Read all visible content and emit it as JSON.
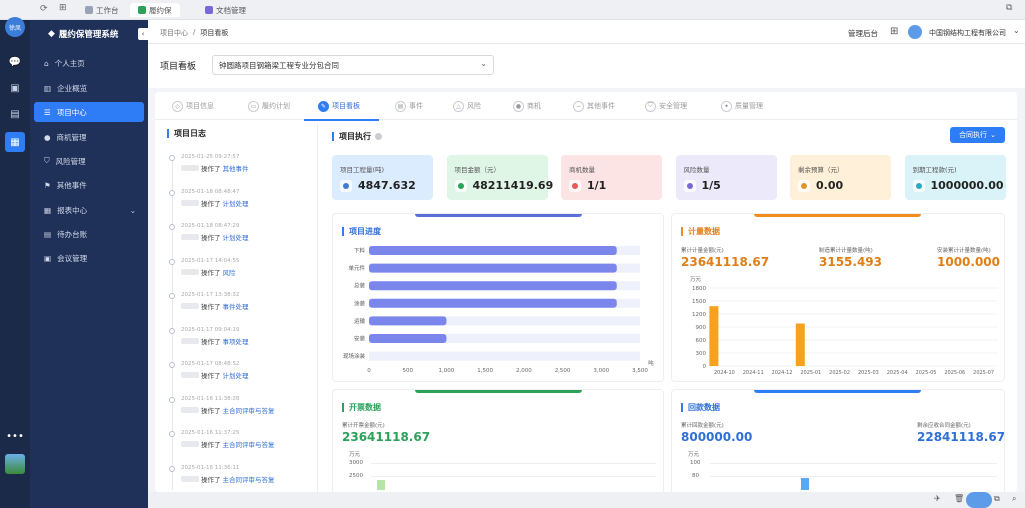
{
  "tabs": [
    {
      "label": "工作台",
      "active": false
    },
    {
      "label": "履约保",
      "active": true
    },
    {
      "label": "文档管理",
      "active": false
    }
  ],
  "rail": {
    "user_initials": "徐凤"
  },
  "sidebar": {
    "title": "履约保管理系统",
    "items": [
      {
        "label": "个人主页",
        "icon": "home-icon"
      },
      {
        "label": "企业概览",
        "icon": "building-icon"
      },
      {
        "label": "项目中心",
        "icon": "list-icon",
        "active": true
      },
      {
        "label": "商机管理",
        "icon": "pin-icon"
      },
      {
        "label": "风险管理",
        "icon": "shield-icon"
      },
      {
        "label": "其他事件",
        "icon": "flag-icon"
      },
      {
        "label": "报表中心",
        "icon": "report-icon",
        "has_children": true
      },
      {
        "label": "待办台账",
        "icon": "ledger-icon"
      },
      {
        "label": "会议管理",
        "icon": "meeting-icon"
      }
    ]
  },
  "header": {
    "breadcrumb": [
      "项目中心",
      "项目看板"
    ],
    "admin": "管理后台",
    "company": "中国钢结构工程有限公司"
  },
  "board": {
    "label": "项目看板",
    "selected_contract": "钟圆路项目钢箱梁工程专业分包合同"
  },
  "subtabs": [
    {
      "label": "项目信息"
    },
    {
      "label": "履约计划"
    },
    {
      "label": "项目看板",
      "active": true
    },
    {
      "label": "事件"
    },
    {
      "label": "风险"
    },
    {
      "label": "商机"
    },
    {
      "label": "其他事件"
    },
    {
      "label": "安全管理"
    },
    {
      "label": "质量管理"
    }
  ],
  "log": {
    "title": "项目日志",
    "entries": [
      {
        "time": "2025-01-25 09:27:57",
        "action": "操作了",
        "target": "其他事件"
      },
      {
        "time": "2025-01-18 08:48:47",
        "action": "操作了",
        "target": "计划处理"
      },
      {
        "time": "2025-01-18 08:47:29",
        "action": "操作了",
        "target": "计划处理"
      },
      {
        "time": "2025-01-17 14:04:55",
        "action": "操作了",
        "target": "风险"
      },
      {
        "time": "2025-01-17 13:38:32",
        "action": "操作了",
        "target": "事件处理"
      },
      {
        "time": "2025-01-17 09:04:19",
        "action": "操作了",
        "target": "事项处理"
      },
      {
        "time": "2025-01-17 08:48:52",
        "action": "操作了",
        "target": "计划处理"
      },
      {
        "time": "2025-01-16 11:38:28",
        "action": "操作了",
        "target": "主合同评审与答复"
      },
      {
        "time": "2025-01-16 11:37:25",
        "action": "操作了",
        "target": "主合同评审与答复"
      },
      {
        "time": "2025-01-16 11:36:11",
        "action": "操作了",
        "target": "主合同评审与答复"
      }
    ]
  },
  "execution": {
    "title": "项目执行",
    "button": "合同执行",
    "stats": [
      {
        "label": "项目工程量(吨)",
        "value": "4847.632",
        "bg": "#dcecff",
        "dot": "#3b7dd8"
      },
      {
        "label": "项目金额（元）",
        "value": "48211419.69",
        "bg": "#dff5e6",
        "dot": "#2ba15a"
      },
      {
        "label": "商机数量",
        "value": "1/1",
        "bg": "#fde4e4",
        "dot": "#e65a5a"
      },
      {
        "label": "风险数量",
        "value": "1/5",
        "bg": "#ece9fb",
        "dot": "#7a68d6"
      },
      {
        "label": "剩余预算（元）",
        "value": "0.00",
        "bg": "#fff0d9",
        "dot": "#e2962a"
      },
      {
        "label": "到期工程款(元)",
        "value": "1000000.00",
        "bg": "#d9f3f8",
        "dot": "#2aa9c7"
      }
    ]
  },
  "progress": {
    "title": "项目进度",
    "chart_data": {
      "type": "bar",
      "orientation": "horizontal",
      "categories": [
        "下料",
        "单元件",
        "总装",
        "涂装",
        "运输",
        "安装",
        "现场涂装"
      ],
      "values": [
        3200,
        3200,
        3200,
        3200,
        1000,
        1000,
        0
      ],
      "max_values": [
        3500,
        3500,
        3500,
        3500,
        3500,
        3500,
        3500
      ],
      "xlim": [
        0,
        3500
      ],
      "xticks": [
        "0",
        "500",
        "1,000",
        "1,500",
        "2,000",
        "2,500",
        "3,000",
        "3,500"
      ],
      "xunit": "吨"
    }
  },
  "measure": {
    "title": "计量数据",
    "kpis": [
      {
        "label": "累计计量金额(元)",
        "value": "23641118.67"
      },
      {
        "label": "制造累计计量数量(吨)",
        "value": "3155.493"
      },
      {
        "label": "安装累计计量数量(吨)",
        "value": "1000.000"
      }
    ],
    "chart_data": {
      "type": "bar",
      "categories": [
        "2024-10",
        "2024-11",
        "2024-12",
        "2025-01",
        "2025-02",
        "2025-03",
        "2025-04",
        "2025-05",
        "2025-06",
        "2025-07"
      ],
      "values": [
        1380,
        0,
        0,
        980,
        0,
        0,
        0,
        0,
        0,
        0
      ],
      "ylim": [
        0,
        1800
      ],
      "yticks": [
        "0",
        "150",
        "300",
        "450",
        "600",
        "750",
        "900",
        "1050",
        "1200",
        "1350",
        "1500",
        "1650",
        "1800"
      ],
      "yunit": "万元"
    }
  },
  "invoice": {
    "title": "开票数据",
    "kpi_label": "累计开票金额(元)",
    "kpi_value": "23641118.67",
    "yunit": "万元",
    "yticks": [
      "3000",
      "2500"
    ]
  },
  "payment": {
    "title": "回款数据",
    "kpis": [
      {
        "label": "累计回款金额(元)",
        "value": "800000.00"
      },
      {
        "label": "剩余应收合同金额(元)",
        "value": "22841118.67"
      }
    ],
    "yunit": "万元",
    "yticks": [
      "100",
      "80"
    ]
  }
}
